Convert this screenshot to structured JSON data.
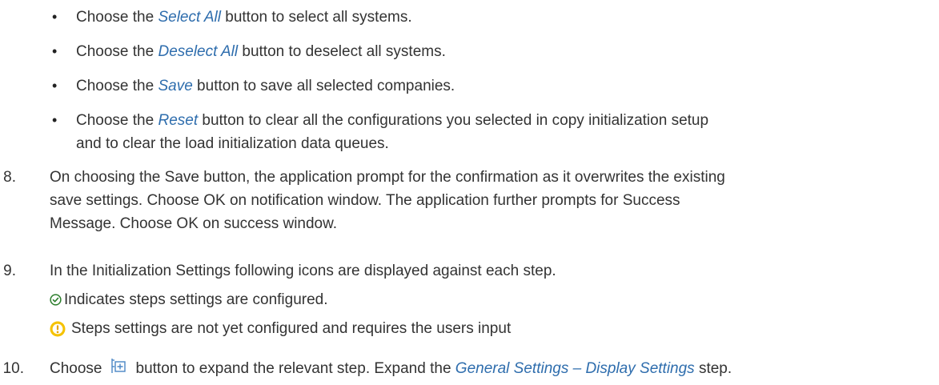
{
  "bullets": [
    {
      "pre": "Choose the ",
      "link": "Select All",
      "post": " button to select all systems."
    },
    {
      "pre": "Choose the ",
      "link": "Deselect All",
      "post": " button to deselect all systems."
    },
    {
      "pre": "Choose the ",
      "link": "Save",
      "post": " button to save all selected companies."
    },
    {
      "pre": "Choose the ",
      "link": "Reset",
      "post": " button to clear all the configurations you selected in copy initialization setup",
      "line2": "and to clear the load initialization data queues."
    }
  ],
  "steps": {
    "s8": {
      "num": "8.",
      "line1": "On choosing the Save button, the application prompt for the confirmation as it overwrites the existing",
      "line2": "save settings. Choose OK on notification window. The application further prompts for Success",
      "line3": "Message. Choose OK on success window."
    },
    "s9": {
      "num": "9.",
      "line1": "In the Initialization Settings following icons are displayed against each step.",
      "check_text": "Indicates steps settings are configured.",
      "warn_text": "Steps settings are not yet configured and requires the users input"
    },
    "s10": {
      "num": "10.",
      "pre": "Choose",
      "mid": "button to expand the relevant step. Expand the ",
      "link": "General Settings – Display Settings",
      "post": " step."
    }
  },
  "icons": {
    "check": "check-circle-icon",
    "warn": "warning-circle-icon",
    "expand": "expand-all-icon"
  },
  "colors": {
    "link": "#2e6dad",
    "check": "#2b7d2b",
    "warn": "#e9b400"
  }
}
